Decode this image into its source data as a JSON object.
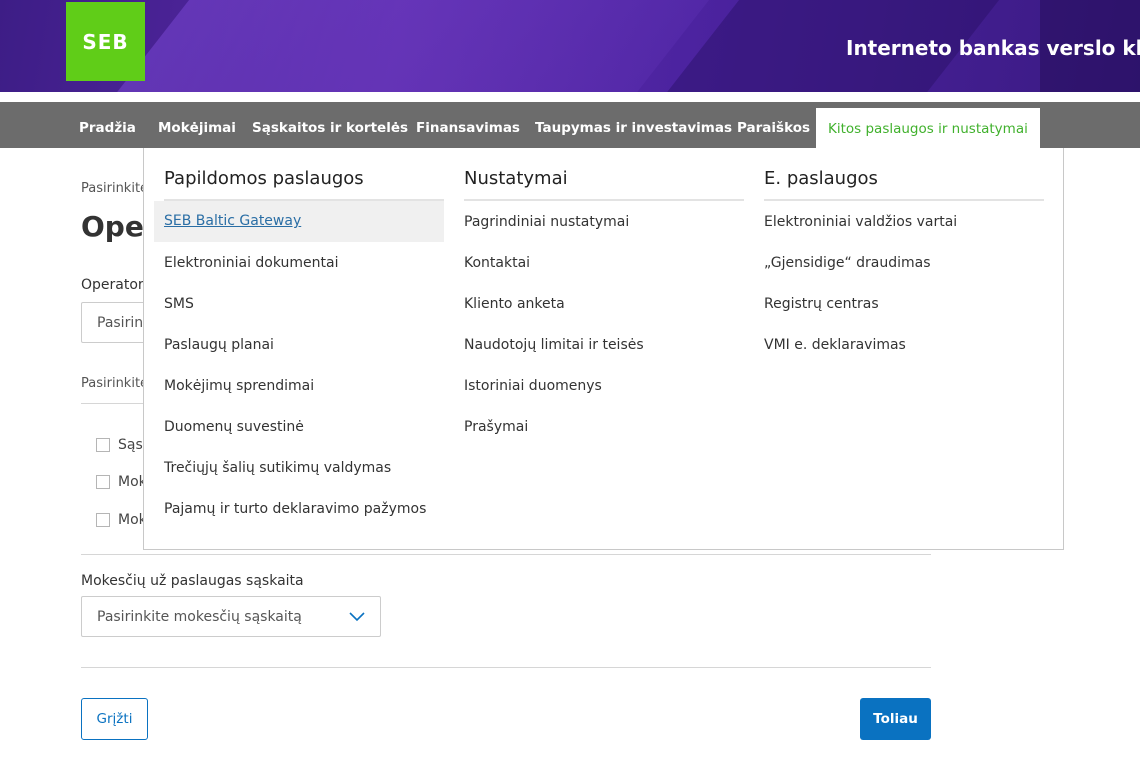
{
  "header": {
    "logo_text": "SEB",
    "title": "Interneto bankas verslo klie",
    "logo_color": "#60cd18",
    "banner_color": "#4c23a0"
  },
  "nav": {
    "items": [
      {
        "label": "Pradžia"
      },
      {
        "label": "Mokėjimai"
      },
      {
        "label": "Sąskaitos ir kortelės"
      },
      {
        "label": "Finansavimas"
      },
      {
        "label": "Taupymas ir investavimas"
      },
      {
        "label": "Paraiškos"
      },
      {
        "label": "Kitos paslaugos ir nustatymai",
        "active": true
      }
    ]
  },
  "mega_menu": {
    "columns": [
      {
        "title": "Papildomos paslaugos",
        "links": [
          "SEB Baltic Gateway",
          "Elektroniniai dokumentai",
          "SMS",
          "Paslaugų planai",
          "Mokėjimų sprendimai",
          "Duomenų suvestinė",
          "Trečiųjų šalių sutikimų valdymas",
          "Pajamų ir turto deklaravimo pažymos"
        ],
        "highlighted_index": 0
      },
      {
        "title": "Nustatymai",
        "links": [
          "Pagrindiniai nustatymai",
          "Kontaktai",
          "Kliento anketa",
          "Naudotojų limitai ir teisės",
          "Istoriniai duomenys",
          "Prašymai"
        ]
      },
      {
        "title": "E. paslaugos",
        "links": [
          "Elektroniniai valdžios vartai",
          "„Gjensidige“ draudimas",
          "Registrų centras",
          "VMI e. deklaravimas"
        ]
      }
    ]
  },
  "page": {
    "breadcrumb": "Pasirinkite",
    "title": "Oper",
    "operator_label": "Operatori",
    "operator_placeholder": "Pasirink",
    "select_label": "Pasirinkite",
    "checkboxes": [
      "Sąs",
      "Mok",
      "Mok"
    ],
    "fee_label": "Mokesčių už paslaugas sąskaita",
    "fee_placeholder": "Pasirinkite mokesčių sąskaitą",
    "back_label": "Grįžti",
    "next_label": "Toliau",
    "accent_color": "#0a72c1",
    "active_nav_color": "#41b12d"
  }
}
